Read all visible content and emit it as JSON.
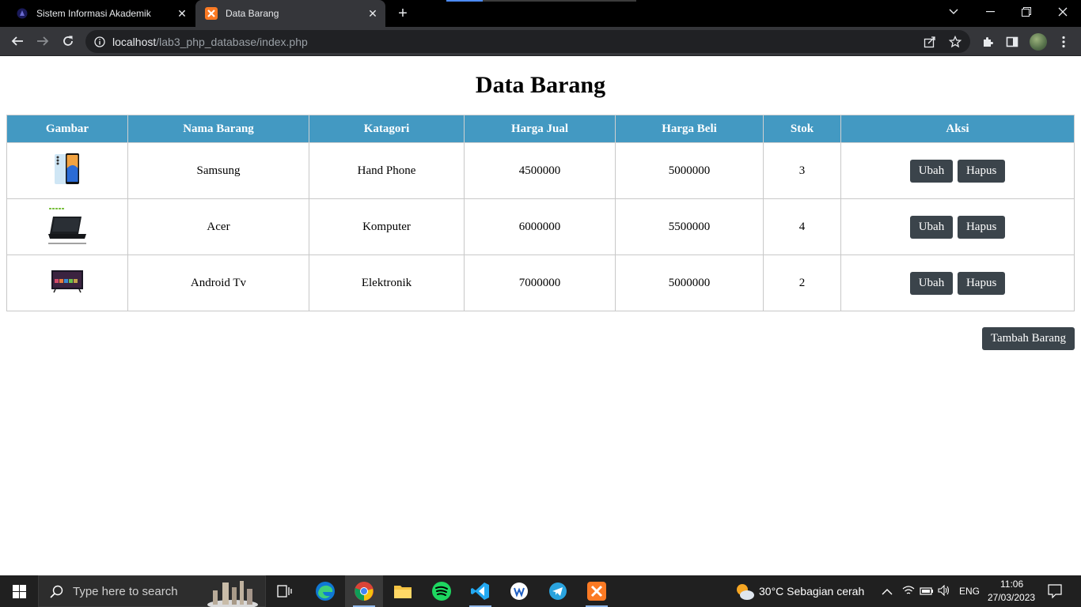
{
  "browser": {
    "tabs": [
      {
        "title": "Sistem Informasi Akademik"
      },
      {
        "title": "Data Barang"
      }
    ],
    "url_host": "localhost",
    "url_path": "/lab3_php_database/index.php"
  },
  "page": {
    "title": "Data Barang",
    "columns": [
      "Gambar",
      "Nama Barang",
      "Katagori",
      "Harga Jual",
      "Harga Beli",
      "Stok",
      "Aksi"
    ],
    "rows": [
      {
        "image": "phone-image",
        "nama": "Samsung",
        "kategori": "Hand Phone",
        "harga_jual": "4500000",
        "harga_beli": "5000000",
        "stok": "3"
      },
      {
        "image": "laptop-image",
        "nama": "Acer",
        "kategori": "Komputer",
        "harga_jual": "6000000",
        "harga_beli": "5500000",
        "stok": "4"
      },
      {
        "image": "tv-image",
        "nama": "Android Tv",
        "kategori": "Elektronik",
        "harga_jual": "7000000",
        "harga_beli": "5000000",
        "stok": "2"
      }
    ],
    "edit_label": "Ubah",
    "delete_label": "Hapus",
    "add_label": "Tambah Barang",
    "header_color": "#4399c2",
    "button_color": "#3b444b"
  },
  "taskbar": {
    "search_placeholder": "Type here to search",
    "weather": "30°C  Sebagian cerah",
    "language": "ENG",
    "time": "11:06",
    "date": "27/03/2023"
  }
}
